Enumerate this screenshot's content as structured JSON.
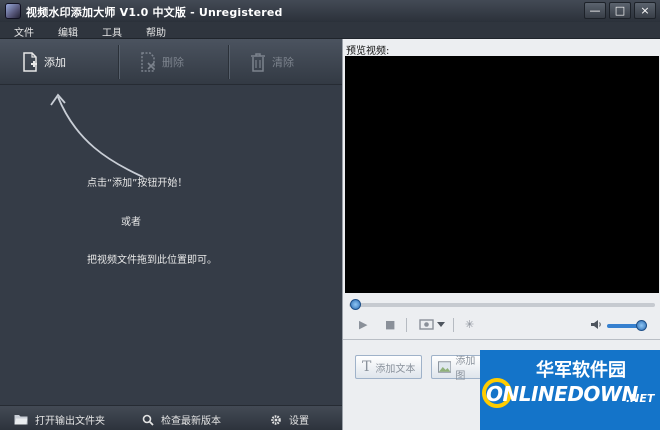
{
  "window": {
    "title": "视频水印添加大师 V1.0 中文版 - Unregistered",
    "controls": [
      "—",
      "□",
      "×"
    ]
  },
  "menu": [
    "文件",
    "编辑",
    "工具",
    "帮助"
  ],
  "toolbar": {
    "add": "添加",
    "delete": "删除",
    "clear": "清除"
  },
  "hints": {
    "line1": "点击“添加”按钮开始！",
    "line2": "或者",
    "line3": "把视频文件拖到此位置即可。"
  },
  "bottombar": {
    "open_output": "打开输出文件夹",
    "check_update": "检查最新版本",
    "settings": "设置"
  },
  "preview": {
    "label": "预览视频:",
    "progress": 0,
    "volume": 0.9
  },
  "right_buttons": {
    "add_text": "添加文本",
    "add_image": "添加图"
  },
  "watermark": {
    "cn": "华军软件园",
    "en": "ONLINEDOWN",
    "net": ".NET"
  },
  "colors": {
    "accent": "#3680cf",
    "panel": "#353c47",
    "watermark_bg": "#1474c9"
  }
}
